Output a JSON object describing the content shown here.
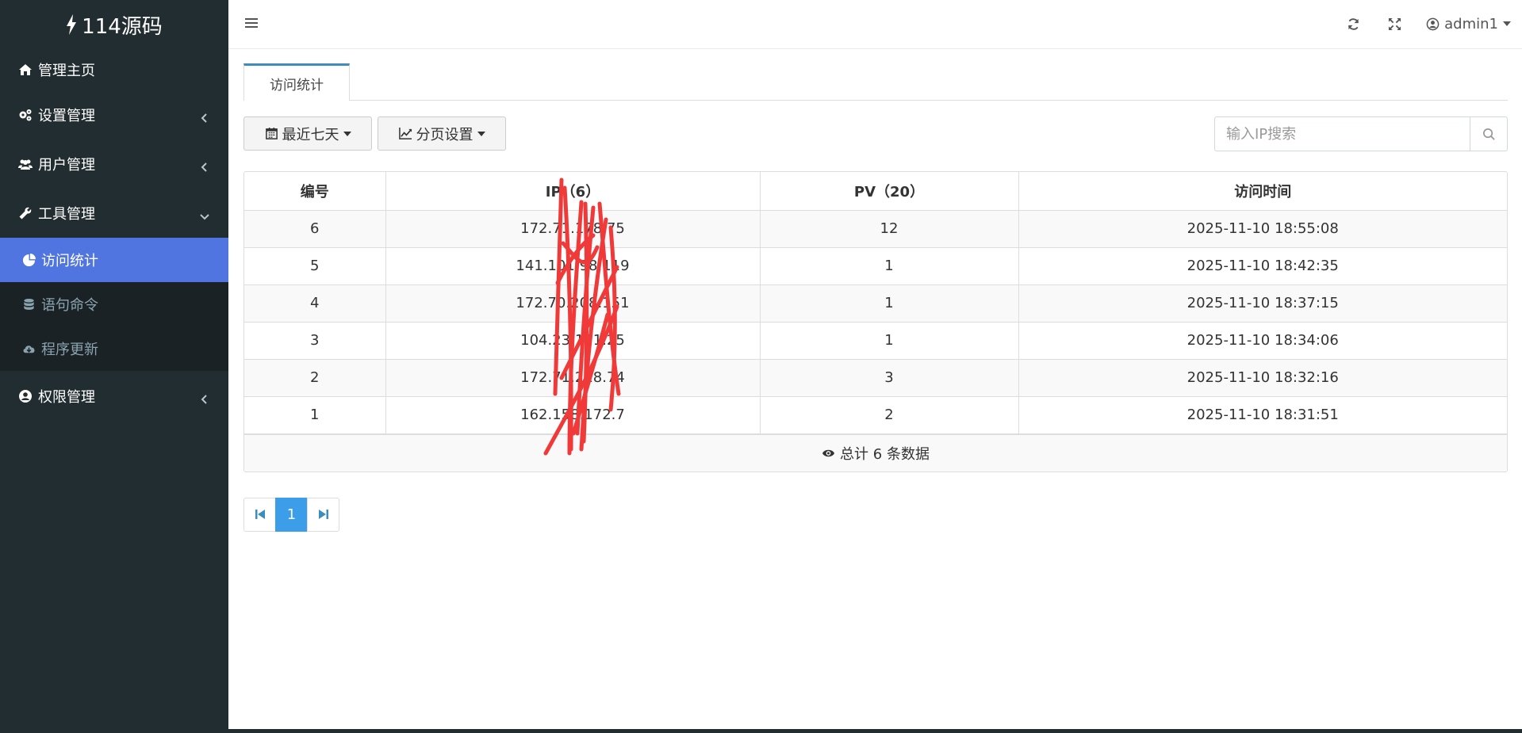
{
  "app": {
    "logo_text": "114源码"
  },
  "sidebar": {
    "items": [
      {
        "label": "管理主页",
        "icon": "home-icon"
      },
      {
        "label": "设置管理",
        "icon": "gears-icon"
      },
      {
        "label": "用户管理",
        "icon": "users-icon"
      },
      {
        "label": "工具管理",
        "icon": "wrench-icon"
      },
      {
        "label": "权限管理",
        "icon": "user-circle-icon"
      }
    ],
    "tools_submenu": [
      {
        "label": "访问统计",
        "icon": "pie-chart-icon",
        "active": true
      },
      {
        "label": "语句命令",
        "icon": "database-icon"
      },
      {
        "label": "程序更新",
        "icon": "cloud-download-icon"
      }
    ]
  },
  "topbar": {
    "username": "admin1"
  },
  "tabs": [
    {
      "label": "访问统计"
    }
  ],
  "toolbar": {
    "date_filter_label": "最近七天",
    "page_settings_label": "分页设置",
    "search_placeholder": "输入IP搜索"
  },
  "table": {
    "headers": [
      "编号",
      "IP（6）",
      "PV（20）",
      "访问时间"
    ],
    "rows": [
      {
        "id": "6",
        "ip": "172.71.178.75",
        "pv": "12",
        "time": "2025-11-10 18:55:08"
      },
      {
        "id": "5",
        "ip": "141.101.98.119",
        "pv": "1",
        "time": "2025-11-10 18:42:35"
      },
      {
        "id": "4",
        "ip": "172.70.208.151",
        "pv": "1",
        "time": "2025-11-10 18:37:15"
      },
      {
        "id": "3",
        "ip": "104.23.171.25",
        "pv": "1",
        "time": "2025-11-10 18:34:06"
      },
      {
        "id": "2",
        "ip": "172.71.218.74",
        "pv": "3",
        "time": "2025-11-10 18:32:16"
      },
      {
        "id": "1",
        "ip": "162.158.172.7",
        "pv": "2",
        "time": "2025-11-10 18:31:51"
      }
    ],
    "total_text": "总计 6 条数据"
  },
  "pagination": {
    "current": "1"
  },
  "colors": {
    "sidebar_bg": "#222d32",
    "active_item": "#5075e0",
    "accent": "#3c8dbc",
    "page_active": "#3c9de8",
    "scribble": "#f03a3a"
  }
}
